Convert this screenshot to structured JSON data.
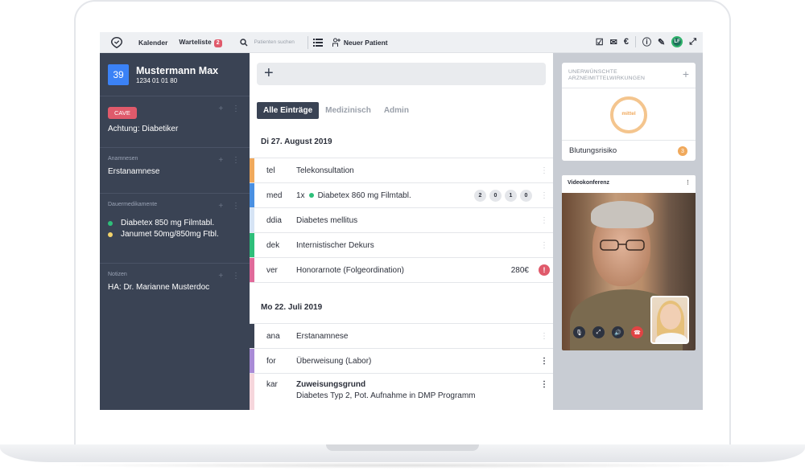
{
  "topbar": {
    "nav_kalender": "Kalender",
    "nav_warteliste": "Warteliste",
    "warteliste_count": "2",
    "search_placeholder": "Patienten suchen",
    "new_patient": "Neuer Patient",
    "avatar_initials": "LF"
  },
  "patient": {
    "number": "39",
    "name": "Mustermann Max",
    "id": "1234 01 01 80"
  },
  "sidebar": {
    "cave_label": "CAVE",
    "cave_text": "Achtung: Diabetiker",
    "anamnesen_title": "Anamnesen",
    "anamnesen_text": "Erstanamnese",
    "dauermed_title": "Dauermedikamente",
    "medications": [
      {
        "name": "Diabetex 850 mg Filmtabl.",
        "color": "#2ebf7a"
      },
      {
        "name": "Janumet 50mg/850mg Ftbl.",
        "color": "#f3d36b"
      }
    ],
    "notizen_title": "Notizen",
    "notizen_text": "HA: Dr. Marianne Musterdoc"
  },
  "center": {
    "add_symbol": "+",
    "tabs": [
      "Alle Einträge",
      "Medizinisch",
      "Admin"
    ],
    "day1": "Di 27. August 2019",
    "day1_entries": [
      {
        "code": "tel",
        "text": "Telekonsultation",
        "color": "#f0a95c"
      },
      {
        "code": "med",
        "prefix": "1x",
        "text": "Diabetex 860 mg Filmtabl.",
        "pills": [
          "2",
          "0",
          "1",
          "0"
        ],
        "color": "#4a90e2"
      },
      {
        "code": "ddia",
        "text": "Diabetes mellitus",
        "color": "#d6e4f5"
      },
      {
        "code": "dek",
        "text": "Internistischer Dekurs",
        "color": "#2ebf7a"
      },
      {
        "code": "ver",
        "text": "Honorarnote (Folgeordination)",
        "amount": "280€",
        "warning": "!",
        "color": "#e06a9a"
      }
    ],
    "day2": "Mo 22. Juli 2019",
    "day2_entries": [
      {
        "code": "ana",
        "text": "Erstanamnese",
        "color": "#3a4354"
      },
      {
        "code": "for",
        "text": "Überweisung (Labor)",
        "color": "#a98bd6"
      },
      {
        "code": "kar",
        "title": "Zuweisungsgrund",
        "text": "Diabetes Typ 2, Pot. Aufnahme in DMP Programm",
        "color": "#f6d6dc"
      }
    ]
  },
  "right": {
    "card_title_line1": "UNERWÜNSCHTE",
    "card_title_line2": "ARZNEIMITTELWIRKUNGEN",
    "gauge_label": "mittel",
    "risk_label": "Blutungsrisiko",
    "risk_count": "3",
    "video_title": "Videokonferenz"
  },
  "colors": {
    "sidebar_bg": "#3a4354",
    "accent_blue": "#3b82f6",
    "alert_red": "#e05a6b",
    "warning_orange": "#f0a95c"
  }
}
